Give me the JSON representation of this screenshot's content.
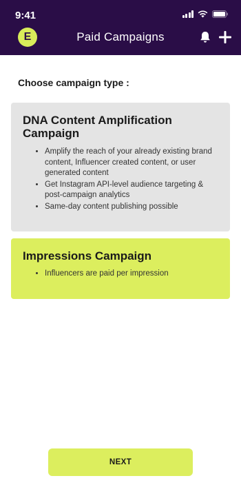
{
  "status_bar": {
    "time": "9:41"
  },
  "header": {
    "logo_letter": "E",
    "title": "Paid Campaigns",
    "icons": [
      "bell-icon",
      "plus-icon"
    ]
  },
  "colors": {
    "header_bg": "#2a0d47",
    "accent": "#dcee5e",
    "card_gray": "#e4e4e4"
  },
  "prompt": "Choose campaign type :",
  "cards": [
    {
      "title": "DNA Content Amplification Campaign",
      "bullets": [
        "Amplify the reach of your already existing brand content, Influencer created content, or user generated content",
        "Get Instagram API-level audience targeting & post-campaign analytics",
        "Same-day content publishing possible"
      ]
    },
    {
      "title": "Impressions Campaign",
      "selected": true,
      "bullets": [
        "Influencers are paid per impression"
      ]
    }
  ],
  "next_label": "NEXT"
}
